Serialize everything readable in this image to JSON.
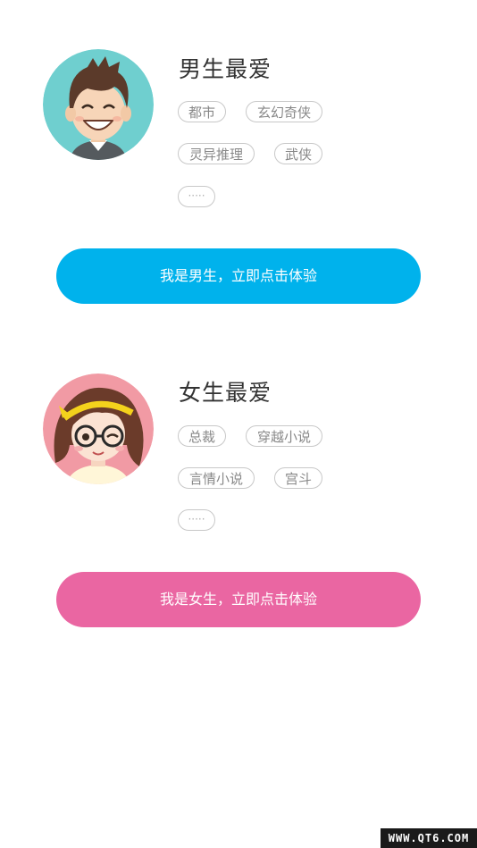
{
  "male": {
    "title": "男生最爱",
    "tags": [
      "都市",
      "玄幻奇侠",
      "灵异推理",
      "武侠"
    ],
    "more": "·····",
    "button_label": "我是男生，立即点击体验",
    "button_color": "#00b2ec",
    "avatar_bg": "#6fcfcf"
  },
  "female": {
    "title": "女生最爱",
    "tags": [
      "总裁",
      "穿越小说",
      "言情小说",
      "宫斗"
    ],
    "more": "·····",
    "button_label": "我是女生，立即点击体验",
    "button_color": "#ea66a2",
    "avatar_bg": "#f19aa4"
  },
  "watermark": "WWW.QT6.COM"
}
